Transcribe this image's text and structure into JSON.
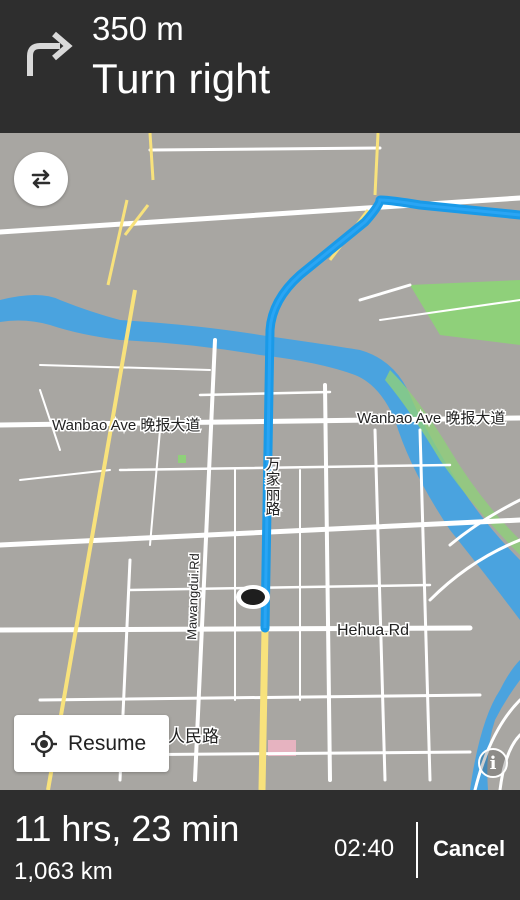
{
  "header": {
    "distance": "350 m",
    "instruction": "Turn right",
    "turn_icon": "turn-right-arrow-icon"
  },
  "map": {
    "labels": {
      "wanbao_west": "Wanbao Ave 晚报大道",
      "wanbao_east": "Wanbao Ave 晚报大道",
      "route_road": "万家丽路",
      "mawangdui": "Mawangdui.Rd",
      "hehua": "Hehua.Rd",
      "renmin": "人民路"
    },
    "colors": {
      "background": "#a8a6a2",
      "road": "#ffffff",
      "highway": "#f8e27c",
      "river": "#4aa3df",
      "route": "#1a9ae8",
      "park": "#8fd07a",
      "bar": "#2e2e2e"
    }
  },
  "controls": {
    "swap_icon": "swap-arrows-icon",
    "resume_label": "Resume",
    "resume_icon": "locate-target-icon",
    "info_icon": "info-icon",
    "info_glyph": "i"
  },
  "footer": {
    "duration": "11 hrs, 23 min",
    "distance": "1,063 km",
    "eta": "02:40",
    "cancel_label": "Cancel"
  }
}
